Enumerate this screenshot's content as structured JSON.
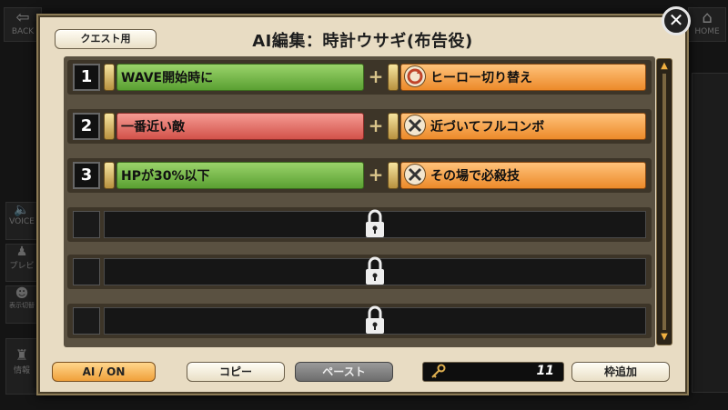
{
  "background": {
    "top_left_label": "BACK",
    "top_right_label": "HOME",
    "left_labels": [
      "VOICE",
      "プレビ",
      "表示切替",
      "情報"
    ]
  },
  "dialog": {
    "title": "AI編集：時計ウサギ(布告役)",
    "quest_button": "クエスト用",
    "close_glyph": "✕"
  },
  "rows": [
    {
      "number": "1",
      "condition": "WAVE開始時に",
      "condition_color": "green",
      "action": "ヒーロー切り替え",
      "action_icon": "refresh-icon"
    },
    {
      "number": "2",
      "condition": "一番近い敵",
      "condition_color": "red",
      "action": "近づいてフルコンボ",
      "action_icon": "crossed-swords-icon"
    },
    {
      "number": "3",
      "condition": "HPが30%以下",
      "condition_color": "green",
      "action": "その場で必殺技",
      "action_icon": "crossed-swords-icon"
    }
  ],
  "locked_rows": 3,
  "plus_glyph": "+",
  "footer": {
    "ai_toggle": "AI / ON",
    "copy": "コピー",
    "paste": "ペースト",
    "key_count": "11",
    "add_slot": "枠追加"
  },
  "colors": {
    "green": "#6cb43e",
    "red": "#e0635b",
    "orange": "#f09a3e",
    "accent": "#f0a03a"
  }
}
